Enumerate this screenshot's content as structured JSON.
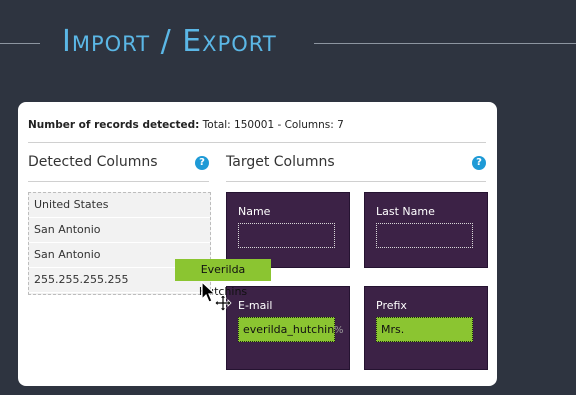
{
  "page": {
    "title": "Import / Export"
  },
  "card": {
    "records_label": "Number of records detected:",
    "records_value": "Total: 150001 - Columns: 7"
  },
  "detected": {
    "title": "Detected Columns",
    "help": "?",
    "items": [
      "United States",
      "San Antonio",
      "San Antonio",
      "255.255.255.255"
    ]
  },
  "target": {
    "title": "Target Columns",
    "help": "?",
    "fields": [
      {
        "label": "Name",
        "value": ""
      },
      {
        "label": "Last Name",
        "value": ""
      },
      {
        "label": "E-mail",
        "value": "everilda_hutchins"
      },
      {
        "label": "Prefix",
        "value": "Mrs."
      }
    ]
  },
  "drag_item": {
    "label": "Everilda Hutchins"
  },
  "overflow_ghost": "%",
  "colors": {
    "background": "#2e3440",
    "accent_title": "#5bb7e6",
    "target_box": "#3c2246",
    "drop_filled": "#8bc531",
    "help_icon": "#1e9ad6"
  },
  "icons": {
    "cursor": "move-cursor-icon",
    "help": "help-icon"
  }
}
